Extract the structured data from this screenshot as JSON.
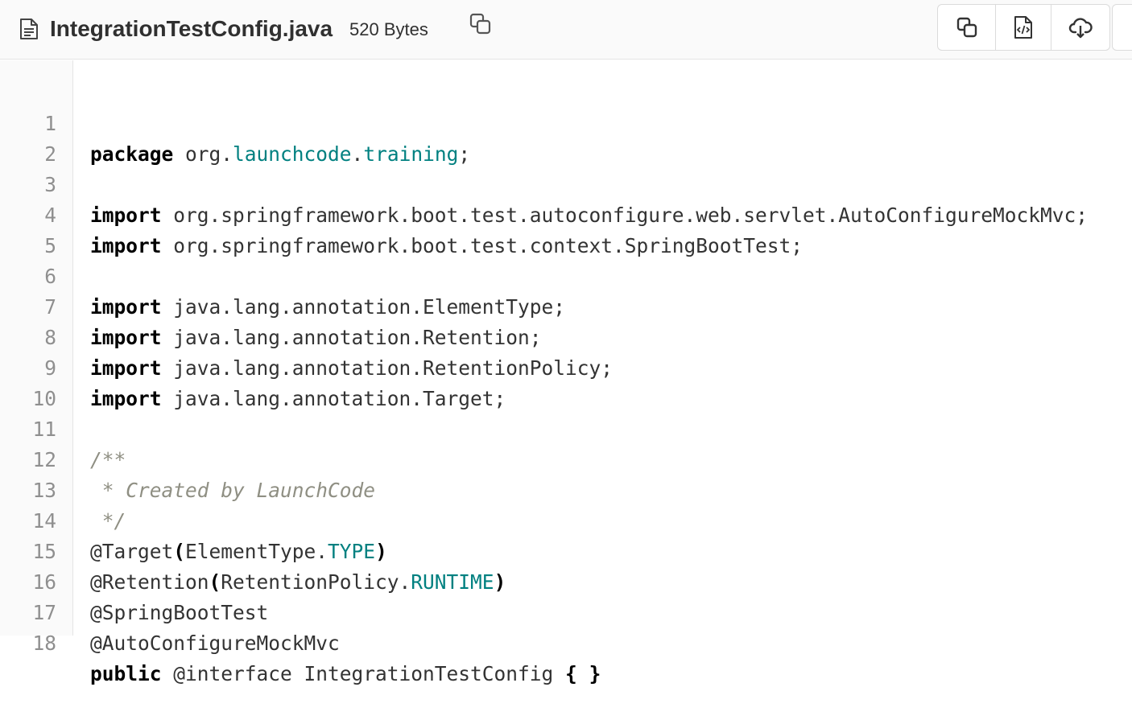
{
  "file": {
    "name": "IntegrationTestConfig.java",
    "size": "520 Bytes"
  },
  "toolbar": {
    "copy_path_icon": "copy-icon",
    "buttons": [
      {
        "name": "copy-contents-button",
        "icon": "copy-icon"
      },
      {
        "name": "open-raw-button",
        "icon": "file-code-icon"
      },
      {
        "name": "download-button",
        "icon": "cloud-download-icon"
      }
    ]
  },
  "code": {
    "line_numbers": [
      "1",
      "2",
      "3",
      "4",
      "5",
      "6",
      "7",
      "8",
      "9",
      "10",
      "11",
      "12",
      "13",
      "14",
      "15",
      "16",
      "17",
      "18"
    ],
    "lines": [
      [
        "package",
        " org.",
        "launchcode",
        ".",
        "training",
        ";"
      ],
      [],
      [
        "import",
        " org.springframework.boot.test.autoconfigure.web.servlet.AutoConfigureMockMvc;"
      ],
      [
        "import",
        " org.springframework.boot.test.context.SpringBootTest;"
      ],
      [],
      [
        "import",
        " java.lang.annotation.ElementType;"
      ],
      [
        "import",
        " java.lang.annotation.Retention;"
      ],
      [
        "import",
        " java.lang.annotation.RetentionPolicy;"
      ],
      [
        "import",
        " java.lang.annotation.Target;"
      ],
      [],
      [
        "/**"
      ],
      [
        " * Created by LaunchCode"
      ],
      [
        " */"
      ],
      [
        "@Target",
        "(",
        "ElementType.",
        "TYPE",
        ")"
      ],
      [
        "@Retention",
        "(",
        "RetentionPolicy.",
        "RUNTIME",
        ")"
      ],
      [
        "@SpringBootTest"
      ],
      [
        "@AutoConfigureMockMvc"
      ],
      [
        "public",
        " @interface IntegrationTestConfig ",
        "{",
        " ",
        "}"
      ]
    ]
  },
  "colors": {
    "keyword": "#000000",
    "type": "#008080",
    "comment": "#8f8f83",
    "line_number": "#8f8f8f"
  }
}
